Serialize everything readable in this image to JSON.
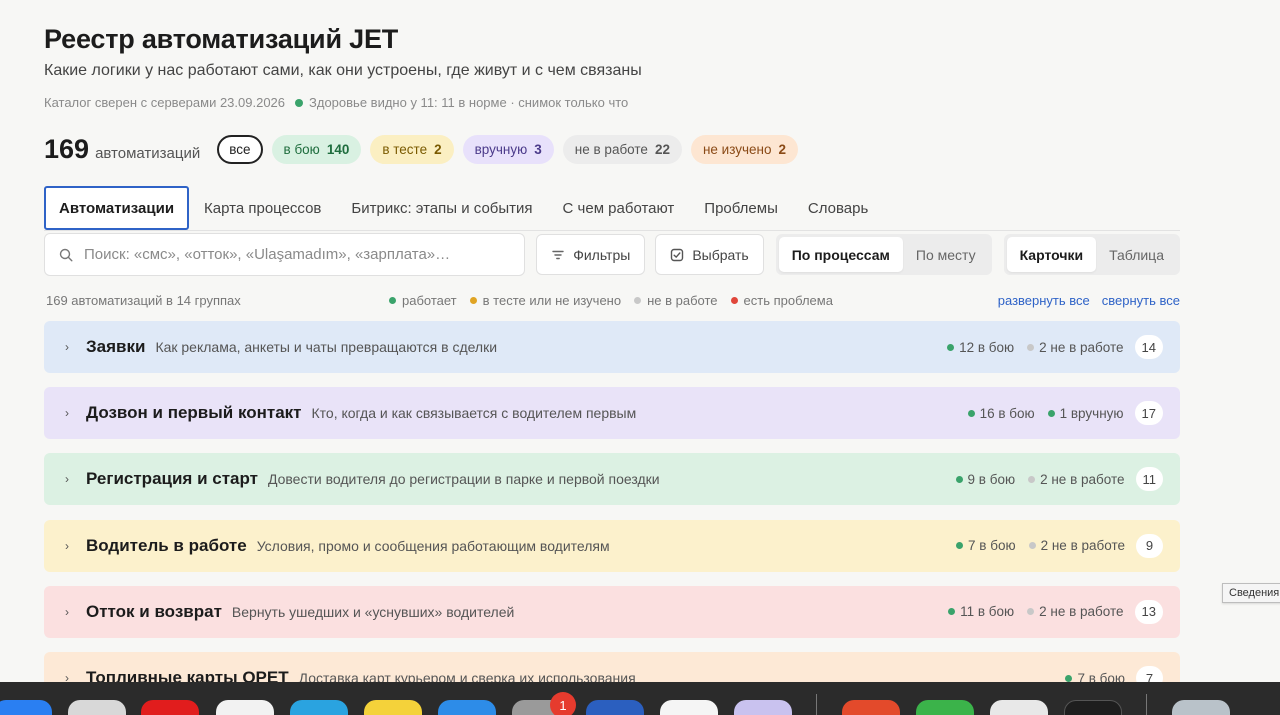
{
  "header": {
    "title": "Реестр автоматизаций JET",
    "subtitle": "Какие логики у нас работают сами, как они устроены, где живут и с чем связаны",
    "catalog_synced": "Каталог сверен с серверами 23.09.2026",
    "health": "Здоровье видно у 11: 11 в норме · снимок только что"
  },
  "counts": {
    "total": "169",
    "total_word": "автоматизаций",
    "chips": [
      {
        "label": "все",
        "value": ""
      },
      {
        "label": "в бою",
        "value": "140"
      },
      {
        "label": "в тесте",
        "value": "2"
      },
      {
        "label": "вручную",
        "value": "3"
      },
      {
        "label": "не в работе",
        "value": "22"
      },
      {
        "label": "не изучено",
        "value": "2"
      }
    ]
  },
  "tabs": [
    "Автоматизации",
    "Карта процессов",
    "Битрикс: этапы и события",
    "С чем работают",
    "Проблемы",
    "Словарь"
  ],
  "toolbar": {
    "search_placeholder": "Поиск: «смс», «отток», «Ulaşamadım», «зарплата»…",
    "filters_label": "Фильтры",
    "select_label": "Выбрать",
    "group_by": [
      "По процессам",
      "По месту"
    ],
    "view": [
      "Карточки",
      "Таблица"
    ]
  },
  "summary": {
    "text": "169 автоматизаций в 14 группах",
    "legend": [
      {
        "label": "работает",
        "color": "#3aa36b"
      },
      {
        "label": "в тесте или не изучено",
        "color": "#e0a423"
      },
      {
        "label": "не в работе",
        "color": "#c8c8c8"
      },
      {
        "label": "есть проблема",
        "color": "#e0463a"
      }
    ],
    "expand_all": "развернуть все",
    "collapse_all": "свернуть все"
  },
  "groups": [
    {
      "name": "Заявки",
      "desc": "Как реклама, анкеты и чаты превращаются в сделки",
      "color": "#dfe9f7",
      "stats": [
        {
          "text": "12 в бою",
          "dot": "#3aa36b"
        },
        {
          "text": "2 не в работе",
          "dot": "#c8c8c8"
        }
      ],
      "count": "14"
    },
    {
      "name": "Дозвон и первый контакт",
      "desc": "Кто, когда и как связывается с водителем первым",
      "color": "#e9e3f8",
      "stats": [
        {
          "text": "16 в бою",
          "dot": "#3aa36b"
        },
        {
          "text": "1 вручную",
          "dot": "#3aa36b"
        }
      ],
      "count": "17"
    },
    {
      "name": "Регистрация и старт",
      "desc": "Довести водителя до регистрации в парке и первой поездки",
      "color": "#dcf1e3",
      "stats": [
        {
          "text": "9 в бою",
          "dot": "#3aa36b"
        },
        {
          "text": "2 не в работе",
          "dot": "#c8c8c8"
        }
      ],
      "count": "11"
    },
    {
      "name": "Водитель в работе",
      "desc": "Условия, промо и сообщения работающим водителям",
      "color": "#fcf1cc",
      "stats": [
        {
          "text": "7 в бою",
          "dot": "#3aa36b"
        },
        {
          "text": "2 не в работе",
          "dot": "#c8c8c8"
        }
      ],
      "count": "9"
    },
    {
      "name": "Отток и возврат",
      "desc": "Вернуть ушедших и «уснувших» водителей",
      "color": "#fbe0e0",
      "stats": [
        {
          "text": "11 в бою",
          "dot": "#3aa36b"
        },
        {
          "text": "2 не в работе",
          "dot": "#c8c8c8"
        }
      ],
      "count": "13"
    },
    {
      "name": "Топливные карты OPET",
      "desc": "Доставка карт курьером и сверка их использования",
      "color": "#fde9d6",
      "stats": [
        {
          "text": "7 в бою",
          "dot": "#3aa36b"
        }
      ],
      "count": "7"
    }
  ],
  "tooltip": "Сведения",
  "dock": {
    "badge": "1"
  }
}
